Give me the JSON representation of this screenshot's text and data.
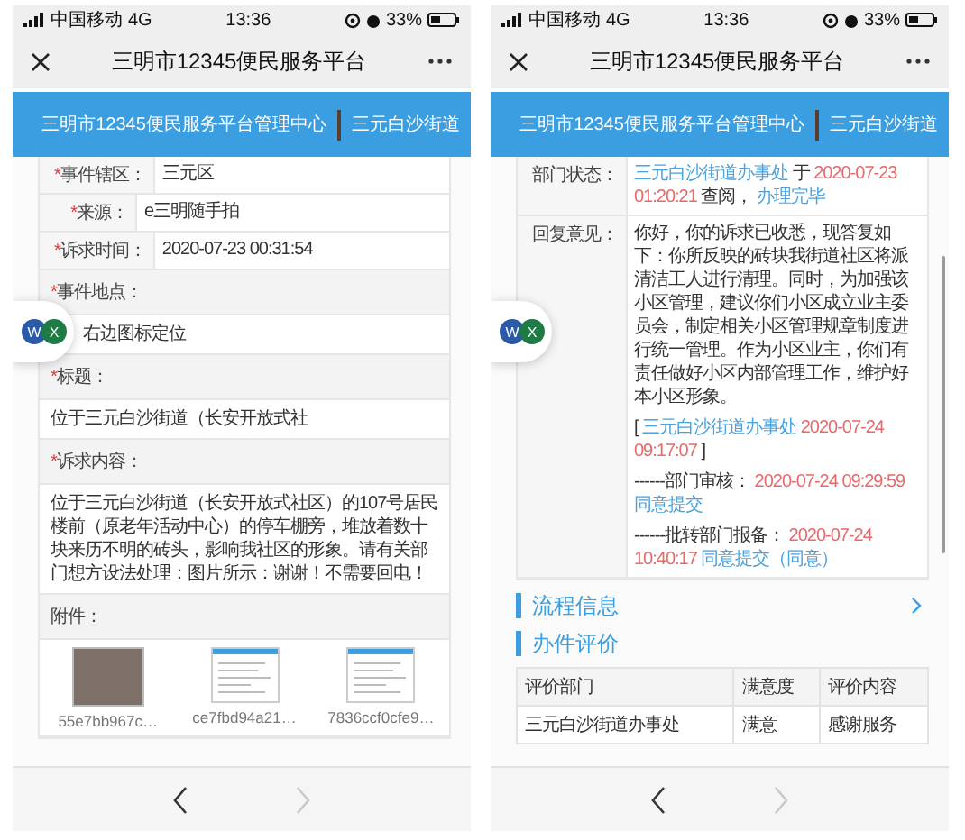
{
  "screens": [
    {
      "status_bar": {
        "carrier": "中国移动",
        "network": "4G",
        "time": "13:36",
        "battery": "33%"
      },
      "title_bar": {
        "title": "三明市12345便民服务平台"
      },
      "header": {
        "title": "三明市12345便民服务平台管理中心",
        "user": "三元白沙街道"
      },
      "blocks": [
        {
          "kind": "field",
          "required": "*",
          "label": "事件辖区：",
          "value": "三元区"
        },
        {
          "kind": "field",
          "required": "*",
          "label": "来源：",
          "value": "e三明随手拍"
        },
        {
          "kind": "field",
          "required": "*",
          "label": "诉求时间：",
          "value": "2020-07-23 00:31:54"
        },
        {
          "kind": "caption",
          "required": "*",
          "label": "事件地点："
        },
        {
          "kind": "location",
          "text": "右边图标定位"
        },
        {
          "kind": "caption",
          "required": "*",
          "label": "标题："
        },
        {
          "kind": "text",
          "text": "位于三元白沙街道（长安开放式社"
        },
        {
          "kind": "caption",
          "required": "*",
          "label": "诉求内容："
        },
        {
          "kind": "text",
          "text": "位于三元白沙街道（长安开放式社区）的107号居民楼前（原老年活动中心）的停车棚旁，堆放着数十块来历不明的砖头，影响我社区的形象。请有关部门想方设法处理：图片所示：谢谢！不需要回电！"
        },
        {
          "kind": "caption",
          "label": "附件："
        },
        {
          "kind": "attachments",
          "items": [
            {
              "kind": "photo",
              "name": "55e7bb967c…"
            },
            {
              "kind": "screenshot",
              "name": "ce7fbd94a21…"
            },
            {
              "kind": "screenshot",
              "name": "7836ccf0cfe9…"
            }
          ]
        }
      ],
      "floating_bubble": {
        "badges": [
          {
            "letter": "W",
            "color": "#2b5aa8"
          },
          {
            "letter": "X",
            "color": "#1e7b45"
          }
        ]
      },
      "nav": [
        {
          "kind": "back",
          "disabled": false
        },
        {
          "kind": "forward",
          "disabled": true
        }
      ]
    },
    {
      "status_bar": {
        "carrier": "中国移动",
        "network": "4G",
        "time": "13:36",
        "battery": "33%"
      },
      "title_bar": {
        "title": "三明市12345便民服务平台"
      },
      "header": {
        "title": "三明市12345便民服务平台管理中心",
        "user": "三元白沙街道"
      },
      "blocks": [
        {
          "kind": "field",
          "label": "部门状态：",
          "paragraphs": [
            [
              {
                "kind": "link",
                "text": "三元白沙街道办事处"
              },
              {
                "kind": "plain",
                "text": "于"
              },
              {
                "kind": "date",
                "text": "2020-07-23 01:20:21"
              },
              {
                "kind": "plain",
                "text": "查阅，"
              },
              {
                "kind": "link",
                "text": "办理完毕"
              }
            ]
          ]
        },
        {
          "kind": "field",
          "label": "回复意见：",
          "paragraphs": [
            [
              {
                "kind": "plain",
                "text": "你好，你的诉求已收悉，现答复如下：你所反映的砖块我街道社区将派清洁工人进行清理。同时，为加强该小区管理，建议你们小区成立业主委员会，制定相关小区管理规章制度进行统一管理。作为小区业主，你们有责任做好小区内部管理工作，维护好本小区形象。"
              }
            ],
            [
              {
                "kind": "plain",
                "text": "["
              },
              {
                "kind": "link",
                "text": "三元白沙街道办事处"
              },
              {
                "kind": "date",
                "text": "2020-07-24 09:17:07"
              },
              {
                "kind": "plain",
                "text": "]"
              }
            ],
            [
              {
                "kind": "plain",
                "text": "------部门审核："
              },
              {
                "kind": "date",
                "text": "2020-07-24 09:29:59"
              },
              {
                "kind": "link",
                "text": "同意提交"
              }
            ],
            [
              {
                "kind": "plain",
                "text": "------批转部门报备："
              },
              {
                "kind": "date",
                "text": "2020-07-24 10:40:17"
              },
              {
                "kind": "link",
                "text": "同意提交（同意）"
              }
            ]
          ]
        },
        {
          "kind": "section",
          "title": "流程信息",
          "chevron": true
        },
        {
          "kind": "section",
          "title": "办件评价",
          "chevron": false
        },
        {
          "kind": "table",
          "columns": [
            "评价部门",
            "满意度",
            "评价内容"
          ],
          "rows": [
            [
              "三元白沙街道办事处",
              "满意",
              "感谢服务"
            ]
          ]
        }
      ],
      "scrollbar": true,
      "floating_bubble": {
        "badges": [
          {
            "letter": "W",
            "color": "#2b5aa8"
          },
          {
            "letter": "X",
            "color": "#1e7b45"
          }
        ]
      },
      "nav": [
        {
          "kind": "back",
          "disabled": false
        },
        {
          "kind": "forward",
          "disabled": true
        }
      ]
    }
  ]
}
